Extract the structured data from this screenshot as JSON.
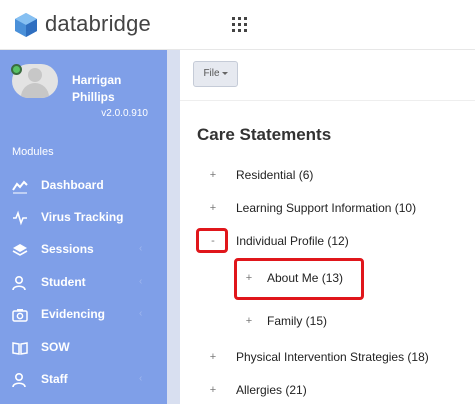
{
  "header": {
    "brand": "databridge",
    "apps_icon": "grid-icon",
    "logo_icon": "hexagon-logo-icon"
  },
  "user": {
    "name": "Harrigan Phillips",
    "version": "v2.0.0.910",
    "status_color": "#58c264"
  },
  "sidebar": {
    "section_label": "Modules",
    "items": [
      {
        "label": "Dashboard",
        "icon": "chart-line-icon"
      },
      {
        "label": "Virus Tracking",
        "icon": "pulse-icon"
      },
      {
        "label": "Sessions",
        "icon": "layers-icon"
      },
      {
        "label": "Student",
        "icon": "user-icon"
      },
      {
        "label": "Evidencing",
        "icon": "camera-icon"
      },
      {
        "label": "SOW",
        "icon": "book-icon"
      },
      {
        "label": "Staff",
        "icon": "user-icon"
      }
    ],
    "bg_color": "#7f9fe8"
  },
  "toolbar": {
    "file_label": "File"
  },
  "main": {
    "title": "Care Statements",
    "tree": [
      {
        "toggle": "+",
        "label": "Residential (6)"
      },
      {
        "toggle": "+",
        "label": "Learning Support Information (10)"
      },
      {
        "toggle": "-",
        "label": "Individual Profile (12)"
      },
      {
        "toggle": "+",
        "label": "About Me (13)"
      },
      {
        "toggle": "+",
        "label": "Family (15)"
      },
      {
        "toggle": "+",
        "label": "Physical Intervention Strategies (18)"
      },
      {
        "toggle": "+",
        "label": "Allergies (21)"
      }
    ],
    "highlight_color": "#e0161b"
  }
}
